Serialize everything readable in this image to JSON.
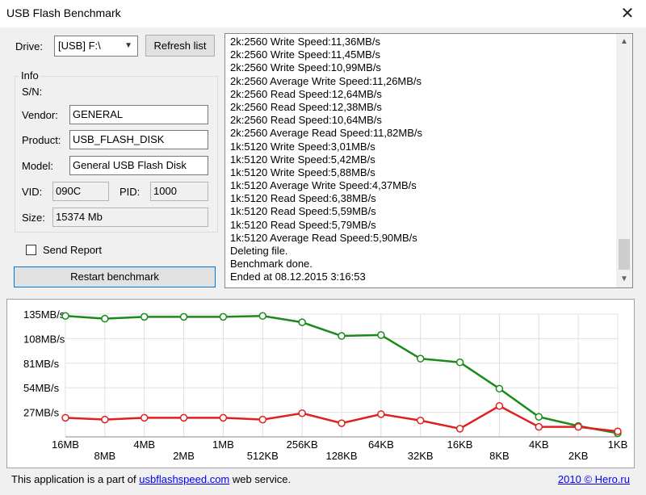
{
  "window": {
    "title": "USB Flash Benchmark",
    "close_glyph": "✕"
  },
  "drive": {
    "label": "Drive:",
    "value": "[USB] F:\\",
    "refresh_label": "Refresh list"
  },
  "info": {
    "group_label": "Info",
    "sn_label": "S/N:",
    "sn_value": "",
    "vendor_label": "Vendor:",
    "vendor_value": "GENERAL",
    "product_label": "Product:",
    "product_value": "USB_FLASH_DISK",
    "model_label": "Model:",
    "model_value": "General USB Flash Disk",
    "vid_label": "VID:",
    "vid_value": "090C",
    "pid_label": "PID:",
    "pid_value": "1000",
    "size_label": "Size:",
    "size_value": "15374 Mb"
  },
  "send_report": {
    "label": "Send Report",
    "checked": false
  },
  "restart_label": "Restart benchmark",
  "log": {
    "lines": [
      "2k:2560 Write Speed:11,36MB/s",
      "2k:2560 Write Speed:11,45MB/s",
      "2k:2560 Write Speed:10,99MB/s",
      "2k:2560 Average Write Speed:11,26MB/s",
      "2k:2560 Read Speed:12,64MB/s",
      "2k:2560 Read Speed:12,38MB/s",
      "2k:2560 Read Speed:10,64MB/s",
      "2k:2560 Average Read Speed:11,82MB/s",
      "1k:5120 Write Speed:3,01MB/s",
      "1k:5120 Write Speed:5,42MB/s",
      "1k:5120 Write Speed:5,88MB/s",
      "1k:5120 Average Write Speed:4,37MB/s",
      "1k:5120 Read Speed:6,38MB/s",
      "1k:5120 Read Speed:5,59MB/s",
      "1k:5120 Read Speed:5,79MB/s",
      "1k:5120 Average Read Speed:5,90MB/s",
      "Deleting file.",
      "Benchmark done.",
      "Ended at 08.12.2015 3:16:53"
    ]
  },
  "chart_data": {
    "type": "line",
    "categories": [
      "16MB",
      "8MB",
      "4MB",
      "2MB",
      "1MB",
      "512KB",
      "256KB",
      "128KB",
      "64KB",
      "32KB",
      "16KB",
      "8KB",
      "4KB",
      "2KB",
      "1KB"
    ],
    "ylim": [
      0,
      135
    ],
    "yticks": [
      "135MB/s",
      "108MB/s",
      "81MB/s",
      "54MB/s",
      "27MB/s"
    ],
    "yticks_values": [
      135,
      108,
      81,
      54,
      27
    ],
    "grid": true,
    "series": [
      {
        "color": "#1a8a1a",
        "values": [
          133,
          130,
          132,
          132,
          132,
          133,
          126,
          111,
          112,
          86,
          82,
          53,
          22,
          12,
          4
        ]
      },
      {
        "color": "#e02020",
        "values": [
          21,
          19,
          21,
          21,
          21,
          19,
          26,
          15,
          25,
          18,
          9,
          34,
          11,
          11,
          6
        ]
      }
    ]
  },
  "footer": {
    "text_before": "This application is a part of ",
    "link": "usbflashspeed.com",
    "text_after": " web service.",
    "copyright": "2010 © Hero.ru"
  }
}
